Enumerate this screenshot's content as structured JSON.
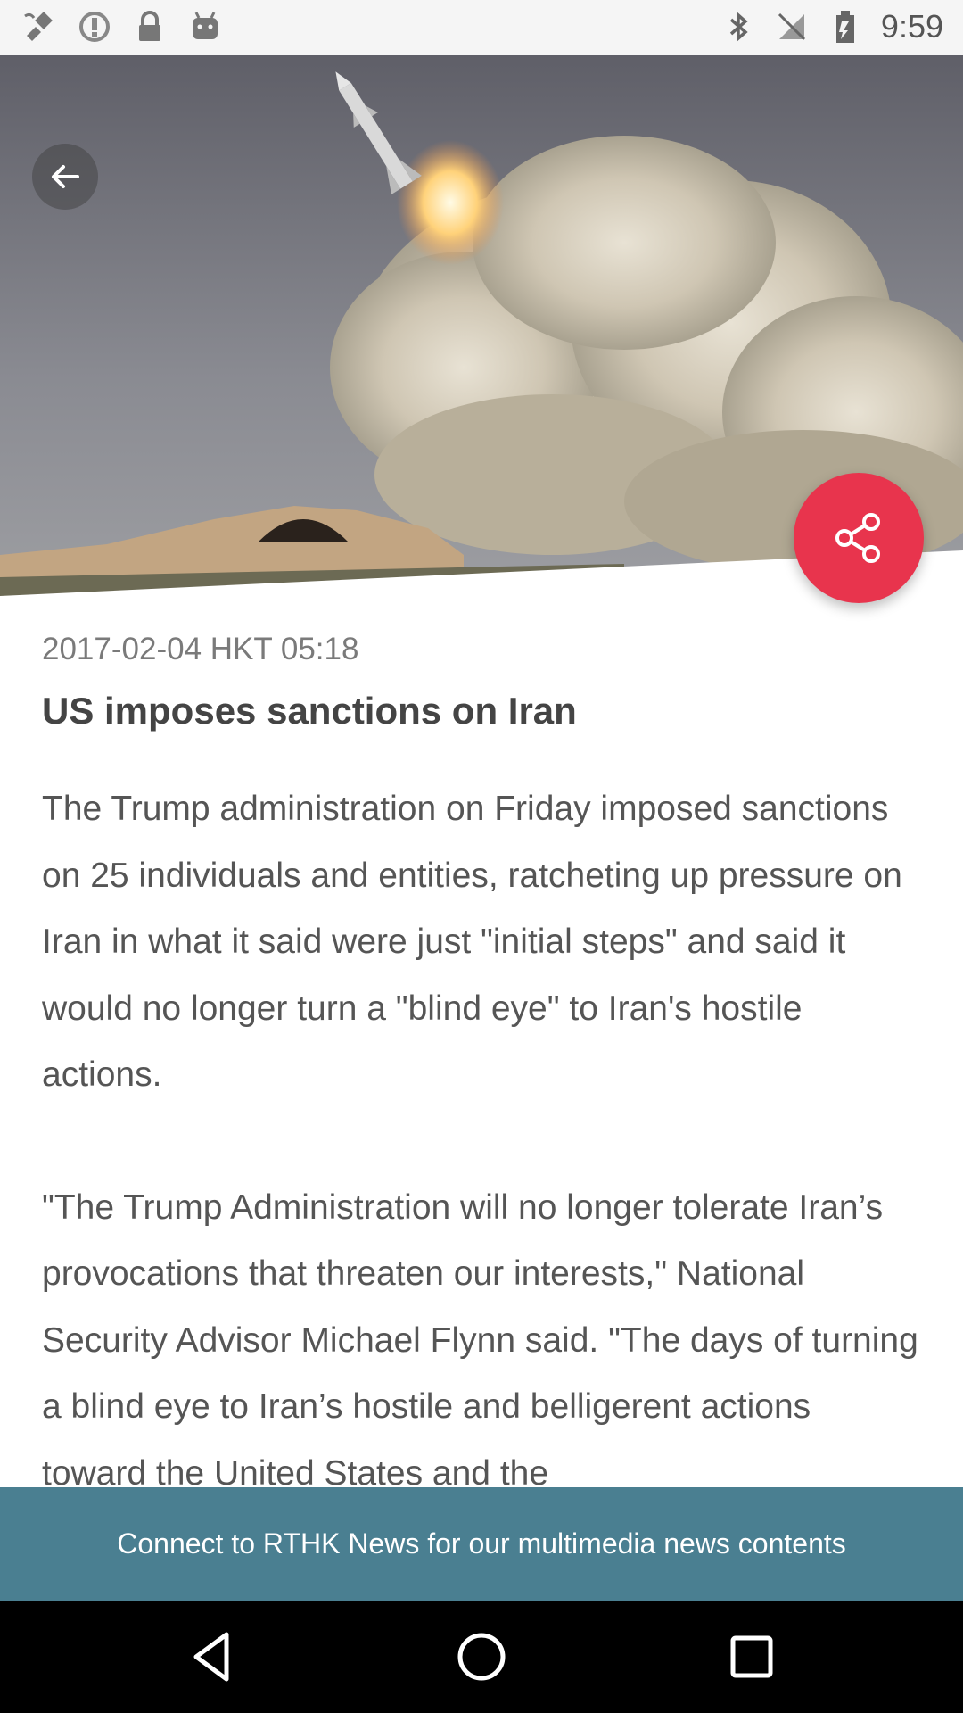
{
  "status_bar": {
    "time": "9:59",
    "left_icons": [
      "fake-gps-icon",
      "alert-circle-icon",
      "lock-icon",
      "android-icon"
    ],
    "right_icons": [
      "bluetooth-icon",
      "signal-off-icon",
      "battery-icon"
    ]
  },
  "hero": {
    "image_description_icon": "missile-launch-photo"
  },
  "article": {
    "date": "2017-02-04 HKT 05:18",
    "title": "US imposes sanctions on Iran",
    "paragraphs": [
      "The Trump administration on Friday imposed sanctions on 25 individuals and entities, ratcheting up pressure on Iran in what it said were just \"initial steps\" and said it would no longer turn a \"blind eye\" to Iran's hostile actions.",
      "\"The Trump Administration will no longer tolerate Iran’s provocations that threaten our interests,\" National Security Advisor Michael Flynn said. \"The days of turning a blind eye to Iran’s hostile and belligerent actions toward the United States and the"
    ]
  },
  "banner": {
    "text": "Connect to RTHK News for our multimedia news contents"
  },
  "colors": {
    "share_button": "#e8344d",
    "banner": "#4a7f91"
  }
}
